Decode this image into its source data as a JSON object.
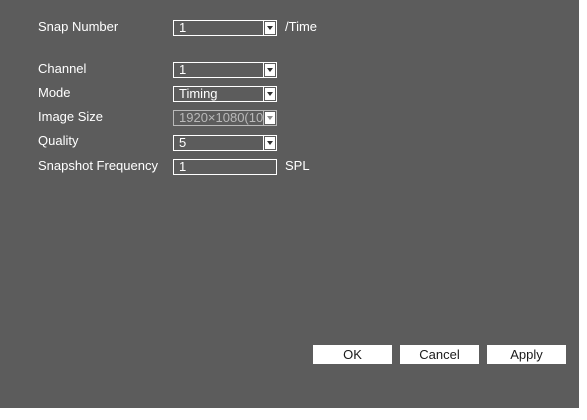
{
  "form": {
    "snap_number": {
      "label": "Snap Number",
      "value": "1",
      "suffix": "/Time"
    },
    "channel": {
      "label": "Channel",
      "value": "1"
    },
    "mode": {
      "label": "Mode",
      "value": "Timing"
    },
    "image_size": {
      "label": "Image Size",
      "value": "1920×1080(10",
      "disabled": true
    },
    "quality": {
      "label": "Quality",
      "value": "5"
    },
    "snapshot_frequency": {
      "label": "Snapshot Frequency",
      "value": "1",
      "suffix": "SPL"
    }
  },
  "buttons": {
    "ok": "OK",
    "cancel": "Cancel",
    "apply": "Apply"
  },
  "colors": {
    "panel_background": "#5c5c5c",
    "text": "#ffffff",
    "disabled_text": "#b9b9b9",
    "button_background": "#ffffff"
  }
}
